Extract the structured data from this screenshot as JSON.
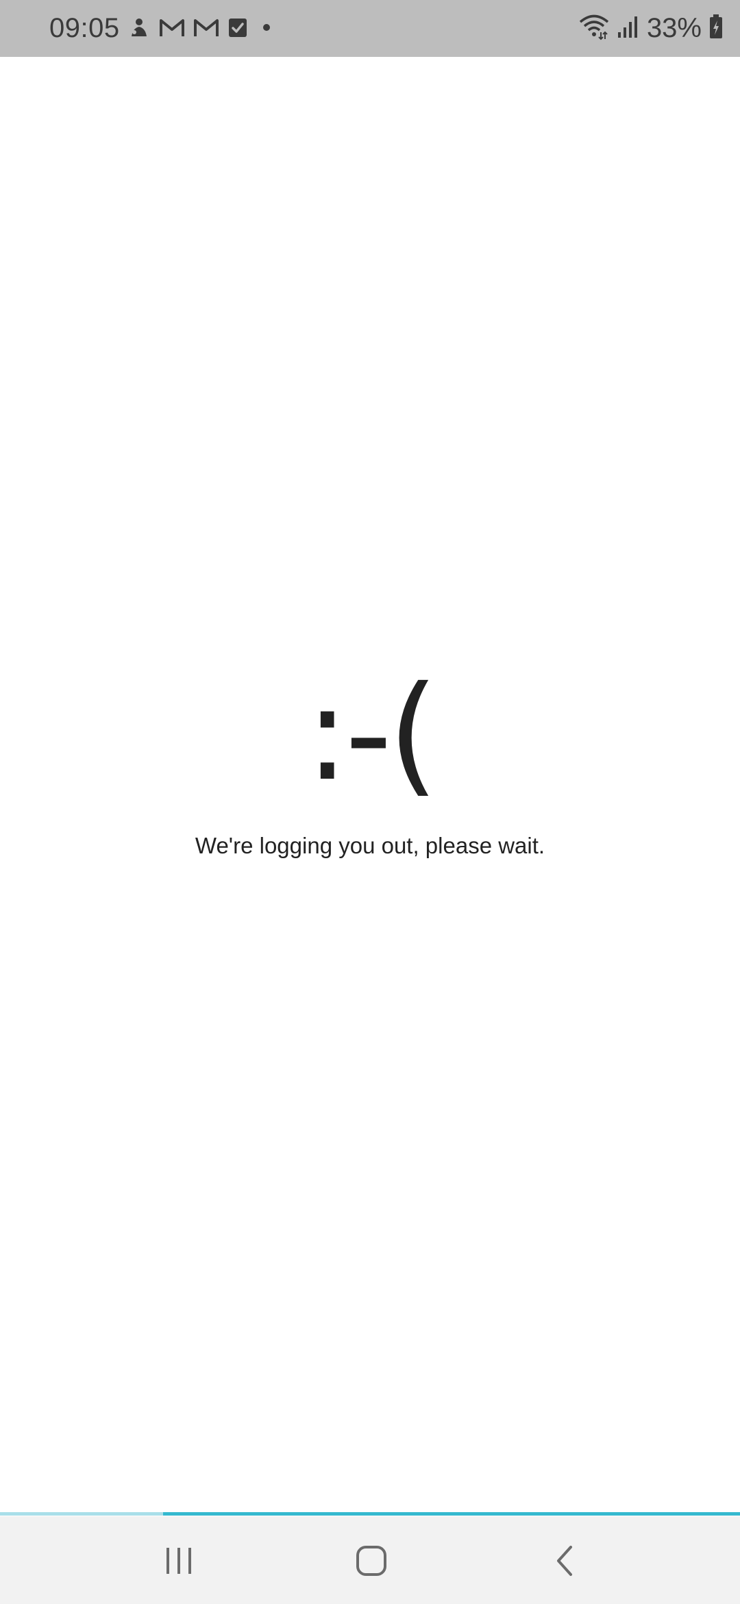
{
  "status_bar": {
    "time": "09:05",
    "battery_percent": "33%",
    "notification_icons": [
      "assistant-icon",
      "gmail-icon",
      "gmail-icon",
      "tasks-check-icon",
      "more-dot-icon"
    ],
    "system_icons": [
      "wifi-icon",
      "signal-icon",
      "battery-charging-icon"
    ]
  },
  "main": {
    "emoticon": ":-(",
    "message": "We're logging you out, please wait."
  },
  "progress": {
    "value_fraction": 0.22,
    "colors": {
      "track": "#35b9cf",
      "fill": "#a9dfe9"
    }
  },
  "nav_bar": {
    "buttons": [
      "recent-apps",
      "home",
      "back"
    ]
  },
  "colors": {
    "status_bar_bg": "#bdbdbd",
    "nav_bar_bg": "#f2f2f2",
    "text": "#222222"
  }
}
